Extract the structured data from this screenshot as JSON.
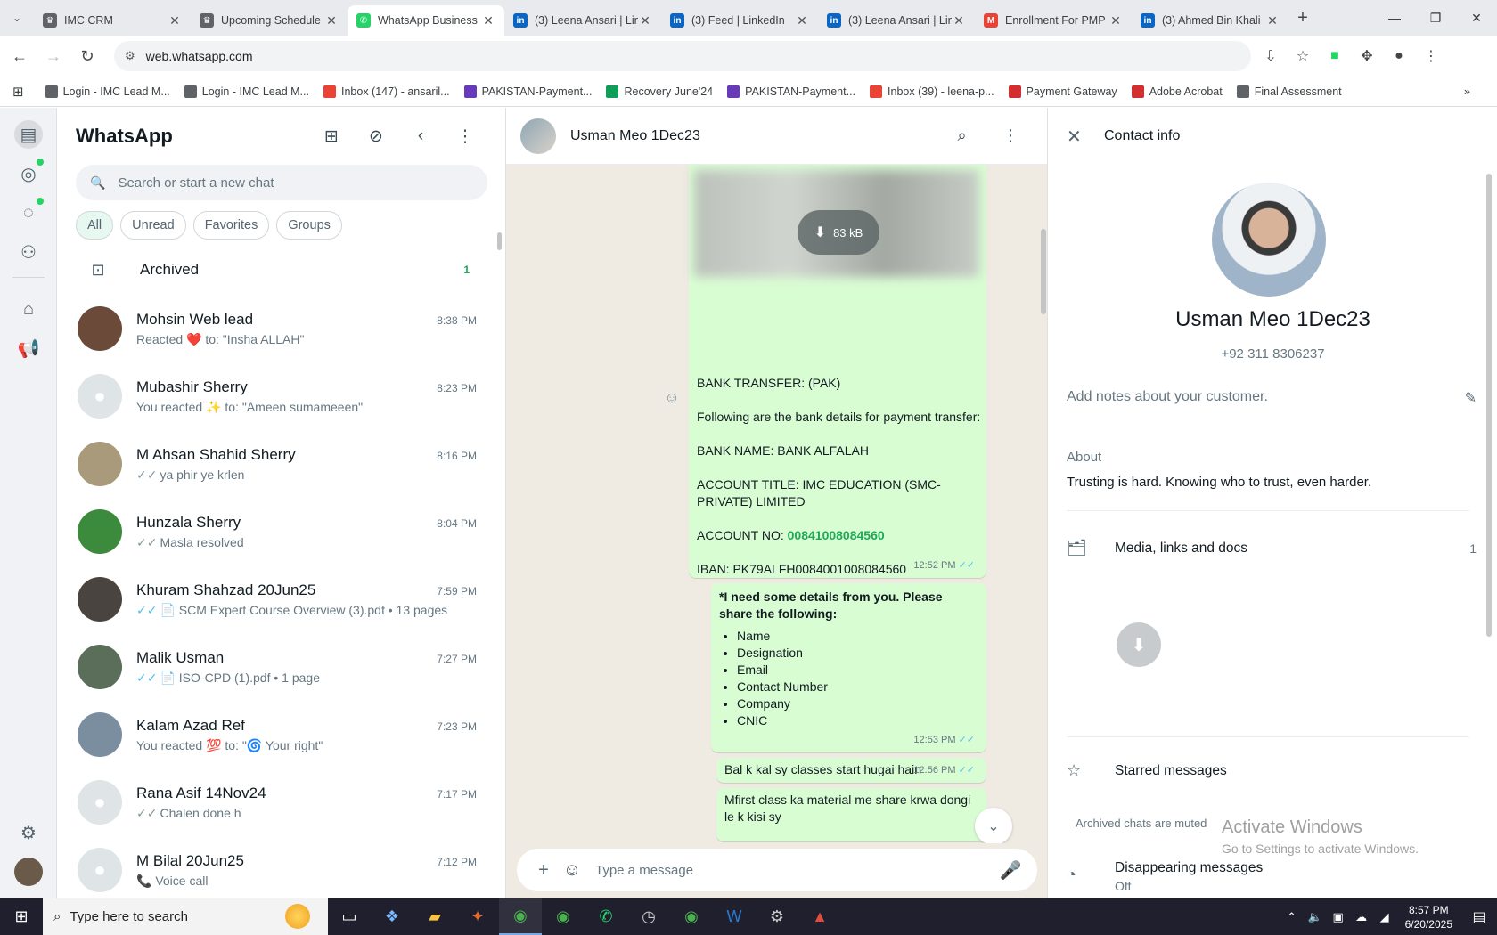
{
  "browser": {
    "tabs": [
      {
        "title": "IMC CRM",
        "color": "#5f6368",
        "glyph": "♛"
      },
      {
        "title": "Upcoming Schedule",
        "color": "#5f6368",
        "glyph": "♛"
      },
      {
        "title": "WhatsApp Business",
        "color": "#25d366",
        "glyph": "✆"
      },
      {
        "title": "(3) Leena Ansari | Lin",
        "color": "#0a66c2",
        "glyph": "in"
      },
      {
        "title": "(3) Feed | LinkedIn",
        "color": "#0a66c2",
        "glyph": "in"
      },
      {
        "title": "(3) Leena Ansari | Lin",
        "color": "#0a66c2",
        "glyph": "in"
      },
      {
        "title": "Enrollment For PMP",
        "color": "#ea4335",
        "glyph": "M"
      },
      {
        "title": "(3) Ahmed Bin Khali",
        "color": "#0a66c2",
        "glyph": "in"
      }
    ],
    "url": "web.whatsapp.com",
    "bookmarks": [
      {
        "label": "Login - IMC Lead M...",
        "color": "#5f6368"
      },
      {
        "label": "Login - IMC Lead M...",
        "color": "#5f6368"
      },
      {
        "label": "Inbox (147) - ansaril...",
        "color": "#ea4335"
      },
      {
        "label": "PAKISTAN-Payment...",
        "color": "#673ab7"
      },
      {
        "label": "Recovery June'24",
        "color": "#0f9d58"
      },
      {
        "label": "PAKISTAN-Payment...",
        "color": "#673ab7"
      },
      {
        "label": "Inbox (39) - leena-p...",
        "color": "#ea4335"
      },
      {
        "label": "Payment Gateway",
        "color": "#d32f2f"
      },
      {
        "label": "Adobe Acrobat",
        "color": "#d32f2f"
      },
      {
        "label": "Final Assessment",
        "color": "#5f6368"
      }
    ]
  },
  "chatlist": {
    "title": "WhatsApp",
    "search_placeholder": "Search or start a new chat",
    "filters": [
      "All",
      "Unread",
      "Favorites",
      "Groups"
    ],
    "archived_label": "Archived",
    "archived_count": "1",
    "chats": [
      {
        "name": "Mohsin Web lead",
        "time": "8:38 PM",
        "preview": "Reacted ❤️ to: \"Insha ALLAH\"",
        "tick": "",
        "avatar": "#6b4a3a"
      },
      {
        "name": "Mubashir Sherry",
        "time": "8:23 PM",
        "preview": "You reacted ✨ to: \"Ameen sumameeen\"",
        "tick": "",
        "avatar": ""
      },
      {
        "name": "M Ahsan Shahid Sherry",
        "time": "8:16 PM",
        "preview": "ya phir ye krlen",
        "tick": "grey",
        "avatar": "#a89a7a"
      },
      {
        "name": "Hunzala Sherry",
        "time": "8:04 PM",
        "preview": "Masla resolved",
        "tick": "grey",
        "avatar": "#3c8a3c"
      },
      {
        "name": "Khuram Shahzad 20Jun25",
        "time": "7:59 PM",
        "preview": "📄 SCM Expert Course Overview (3).pdf • 13 pages",
        "tick": "blue",
        "avatar": "#4a4440"
      },
      {
        "name": "Malik Usman",
        "time": "7:27 PM",
        "preview": "📄 ISO-CPD (1).pdf • 1 page",
        "tick": "blue",
        "avatar": "#5a6e5a"
      },
      {
        "name": "Kalam Azad Ref",
        "time": "7:23 PM",
        "preview": "You reacted 💯 to: \"🌀 Your right\"",
        "tick": "",
        "avatar": "#7a8ea0"
      },
      {
        "name": "Rana Asif 14Nov24",
        "time": "7:17 PM",
        "preview": "Chalen done h",
        "tick": "grey",
        "avatar": ""
      },
      {
        "name": "M Bilal 20Jun25",
        "time": "7:12 PM",
        "preview": "📞 Voice call",
        "tick": "",
        "avatar": ""
      }
    ]
  },
  "conversation": {
    "name": "Usman Meo 1Dec23",
    "download_size": "83 kB",
    "bank_title": "BANK TRANSFER: (PAK)",
    "bank_intro": "Following are the bank details for payment transfer:",
    "bank_name": "BANK NAME: BANK ALFALAH",
    "account_title": "ACCOUNT TITLE: IMC EDUCATION (SMC-PRIVATE) LIMITED",
    "account_no_label": "ACCOUNT NO:",
    "account_no": "00841008084560",
    "iban": "IBAN: PK79ALFH0084001008084560",
    "time1": "12:52 PM",
    "details_heading": "*I need some details from you. Please share the following:",
    "details_items": [
      "Name",
      "Designation",
      "Email",
      "Contact Number",
      "Company",
      "CNIC"
    ],
    "time2": "12:53 PM",
    "msg3": "Bal k kal sy classes start hugai hain",
    "time3": "12:56 PM",
    "msg4": "Mfirst class ka material me share krwa dongi le k kisi sy",
    "composer_placeholder": "Type a message"
  },
  "contact": {
    "header": "Contact info",
    "name": "Usman Meo 1Dec23",
    "phone": "+92 311 8306237",
    "notes_placeholder": "Add notes about your customer.",
    "about_label": "About",
    "about": "Trusting is hard. Knowing who to trust, even harder.",
    "media_label": "Media, links and docs",
    "media_count": "1",
    "starred_label": "Starred messages",
    "muted_label": "Archived chats are muted",
    "disappearing_label": "Disappearing messages",
    "disappearing_value": "Off"
  },
  "watermark": {
    "line1": "Activate Windows",
    "line2": "Go to Settings to activate Windows."
  },
  "taskbar": {
    "search_placeholder": "Type here to search",
    "time": "8:57 PM",
    "date": "6/20/2025"
  }
}
